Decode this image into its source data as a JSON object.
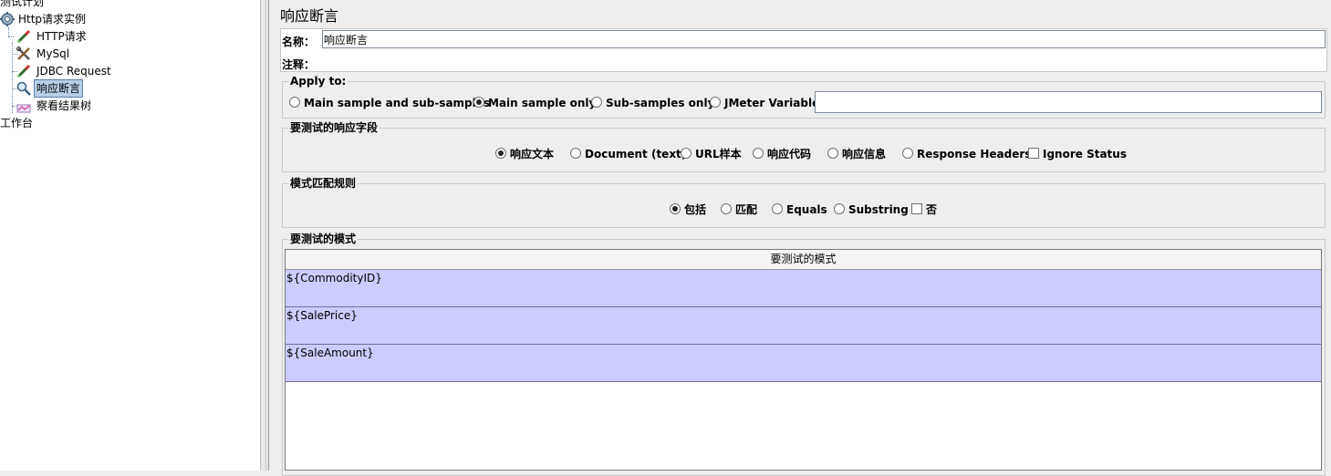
{
  "tree": {
    "items": [
      {
        "label": "测试计划",
        "icon": "test-plan-icon"
      },
      {
        "label": "Http请求实例",
        "icon": "thread-group-gear-icon"
      },
      {
        "label": "HTTP请求",
        "icon": "sampler-dropper-icon"
      },
      {
        "label": "MySql",
        "icon": "config-tools-icon"
      },
      {
        "label": "JDBC Request",
        "icon": "sampler-dropper-icon"
      },
      {
        "label": "响应断言",
        "icon": "magnifier-icon"
      },
      {
        "label": "察看结果树",
        "icon": "listener-chart-icon"
      },
      {
        "label": "工作台",
        "icon": ""
      }
    ],
    "selected": "响应断言"
  },
  "panel": {
    "title": "响应断言",
    "name_label": "名称：",
    "name_value": "响应断言",
    "comment_label": "注释："
  },
  "apply_to": {
    "legend": "Apply to:",
    "options": [
      "Main sample and sub-samples",
      "Main sample only",
      "Sub-samples only",
      "JMeter Variable"
    ],
    "selected": "Main sample only",
    "jmeter_variable_value": ""
  },
  "response_field": {
    "legend": "要测试的响应字段",
    "options": [
      "响应文本",
      "Document (text)",
      "URL样本",
      "响应代码",
      "响应信息",
      "Response Headers"
    ],
    "selected": "响应文本",
    "checkbox_label": "Ignore Status",
    "checkbox_checked": false
  },
  "pattern_rule": {
    "legend": "模式匹配规则",
    "options": [
      "包括",
      "匹配",
      "Equals",
      "Substring"
    ],
    "selected": "包括",
    "checkbox_label": "否",
    "checkbox_checked": false
  },
  "patterns": {
    "legend": "要测试的模式",
    "column_header": "要测试的模式",
    "rows": [
      "${CommodityID}",
      "${SalePrice}",
      "${SaleAmount}"
    ],
    "row_color": "#ccccff"
  }
}
